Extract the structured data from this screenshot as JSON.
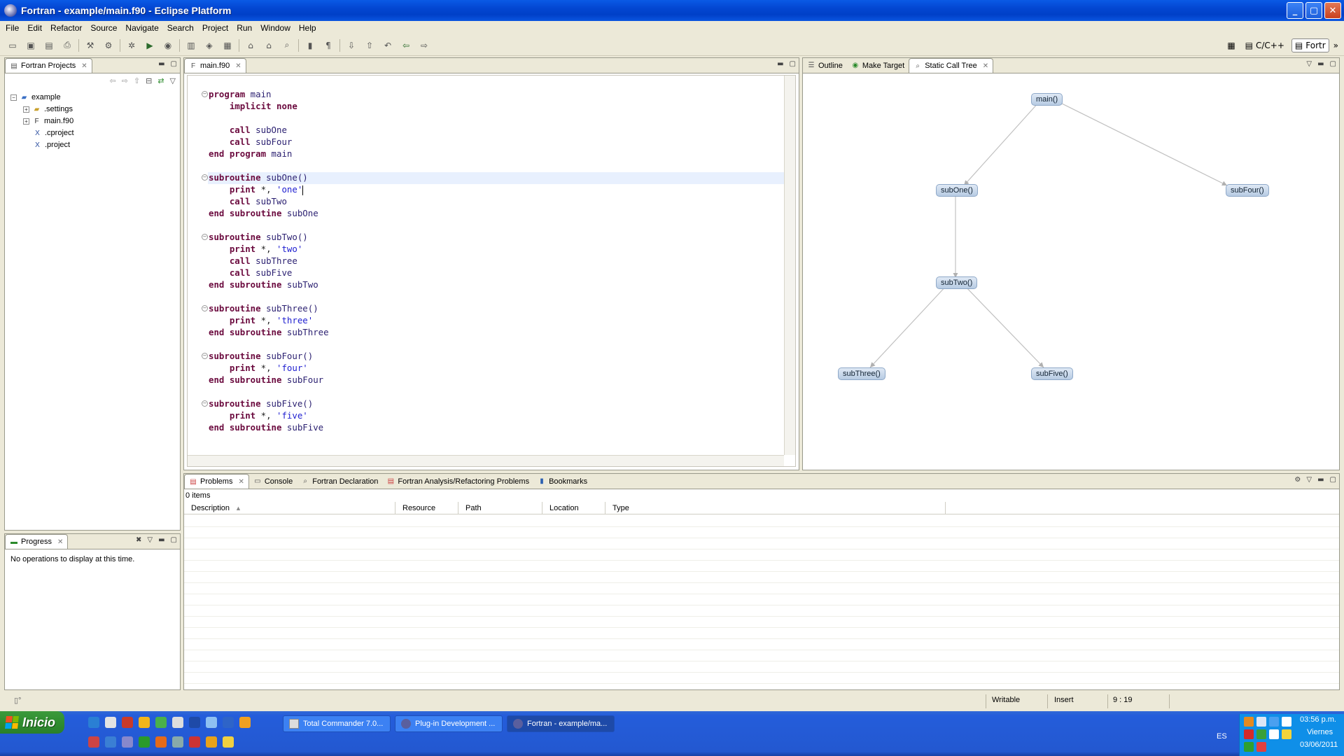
{
  "window": {
    "title": "Fortran - example/main.f90 - Eclipse Platform",
    "min": "_",
    "max": "▢",
    "close": "✕"
  },
  "menu": [
    "File",
    "Edit",
    "Refactor",
    "Source",
    "Navigate",
    "Search",
    "Project",
    "Run",
    "Window",
    "Help"
  ],
  "perspectives": {
    "cpp": "C/C++",
    "fortran": "Fortr",
    "more": "»"
  },
  "projects_view": {
    "title": "Fortran Projects",
    "root": "example",
    "children": [
      ".settings",
      "main.f90",
      ".cproject",
      ".project"
    ]
  },
  "progress_view": {
    "title": "Progress",
    "message": "No operations to display at this time."
  },
  "editor": {
    "tab": "main.f90",
    "lines": [
      [
        [
          "kw",
          "program"
        ],
        [
          "nm",
          " main"
        ]
      ],
      [
        [
          "t",
          "    "
        ],
        [
          "kw",
          "implicit none"
        ]
      ],
      [],
      [
        [
          "t",
          "    "
        ],
        [
          "kw",
          "call"
        ],
        [
          "nm",
          " subOne"
        ]
      ],
      [
        [
          "t",
          "    "
        ],
        [
          "kw",
          "call"
        ],
        [
          "nm",
          " subFour"
        ]
      ],
      [
        [
          "kw",
          "end program"
        ],
        [
          "nm",
          " main"
        ]
      ],
      [],
      [
        [
          "kw",
          "subroutine"
        ],
        [
          "nm",
          " subOne()"
        ]
      ],
      [
        [
          "t",
          "    "
        ],
        [
          "kw",
          "print"
        ],
        [
          "t",
          " *, "
        ],
        [
          "st",
          "'one'"
        ]
      ],
      [
        [
          "t",
          "    "
        ],
        [
          "kw",
          "call"
        ],
        [
          "nm",
          " subTwo"
        ]
      ],
      [
        [
          "kw",
          "end subroutine"
        ],
        [
          "nm",
          " subOne"
        ]
      ],
      [],
      [
        [
          "kw",
          "subroutine"
        ],
        [
          "nm",
          " subTwo()"
        ]
      ],
      [
        [
          "t",
          "    "
        ],
        [
          "kw",
          "print"
        ],
        [
          "t",
          " *, "
        ],
        [
          "st",
          "'two'"
        ]
      ],
      [
        [
          "t",
          "    "
        ],
        [
          "kw",
          "call"
        ],
        [
          "nm",
          " subThree"
        ]
      ],
      [
        [
          "t",
          "    "
        ],
        [
          "kw",
          "call"
        ],
        [
          "nm",
          " subFive"
        ]
      ],
      [
        [
          "kw",
          "end subroutine"
        ],
        [
          "nm",
          " subTwo"
        ]
      ],
      [],
      [
        [
          "kw",
          "subroutine"
        ],
        [
          "nm",
          " subThree()"
        ]
      ],
      [
        [
          "t",
          "    "
        ],
        [
          "kw",
          "print"
        ],
        [
          "t",
          " *, "
        ],
        [
          "st",
          "'three'"
        ]
      ],
      [
        [
          "kw",
          "end subroutine"
        ],
        [
          "nm",
          " subThree"
        ]
      ],
      [],
      [
        [
          "kw",
          "subroutine"
        ],
        [
          "nm",
          " subFour()"
        ]
      ],
      [
        [
          "t",
          "    "
        ],
        [
          "kw",
          "print"
        ],
        [
          "t",
          " *, "
        ],
        [
          "st",
          "'four'"
        ]
      ],
      [
        [
          "kw",
          "end subroutine"
        ],
        [
          "nm",
          " subFour"
        ]
      ],
      [],
      [
        [
          "kw",
          "subroutine"
        ],
        [
          "nm",
          " subFive()"
        ]
      ],
      [
        [
          "t",
          "    "
        ],
        [
          "kw",
          "print"
        ],
        [
          "t",
          " *, "
        ],
        [
          "st",
          "'five'"
        ]
      ],
      [
        [
          "kw",
          "end subroutine"
        ],
        [
          "nm",
          " subFive"
        ]
      ]
    ]
  },
  "right_view": {
    "tabs": [
      "Outline",
      "Make Target",
      "Static Call Tree"
    ],
    "nodes": {
      "main": "main()",
      "subOne": "subOne()",
      "subFour": "subFour()",
      "subTwo": "subTwo()",
      "subThree": "subThree()",
      "subFive": "subFive()"
    }
  },
  "bottom_view": {
    "tabs": [
      "Problems",
      "Console",
      "Fortran Declaration",
      "Fortran Analysis/Refactoring Problems",
      "Bookmarks"
    ],
    "item_count": "0 items",
    "columns": [
      "Description",
      "Resource",
      "Path",
      "Location",
      "Type"
    ]
  },
  "status": {
    "writable": "Writable",
    "mode": "Insert",
    "position": "9 : 19"
  },
  "taskbar": {
    "start": "Inicio",
    "tasks": [
      "Total Commander 7.0...",
      "Plug-in Development ...",
      "Fortran - example/ma..."
    ],
    "lang": "ES",
    "time": "03:56 p.m.",
    "day": "Viernes",
    "date": "03/06/2011"
  }
}
